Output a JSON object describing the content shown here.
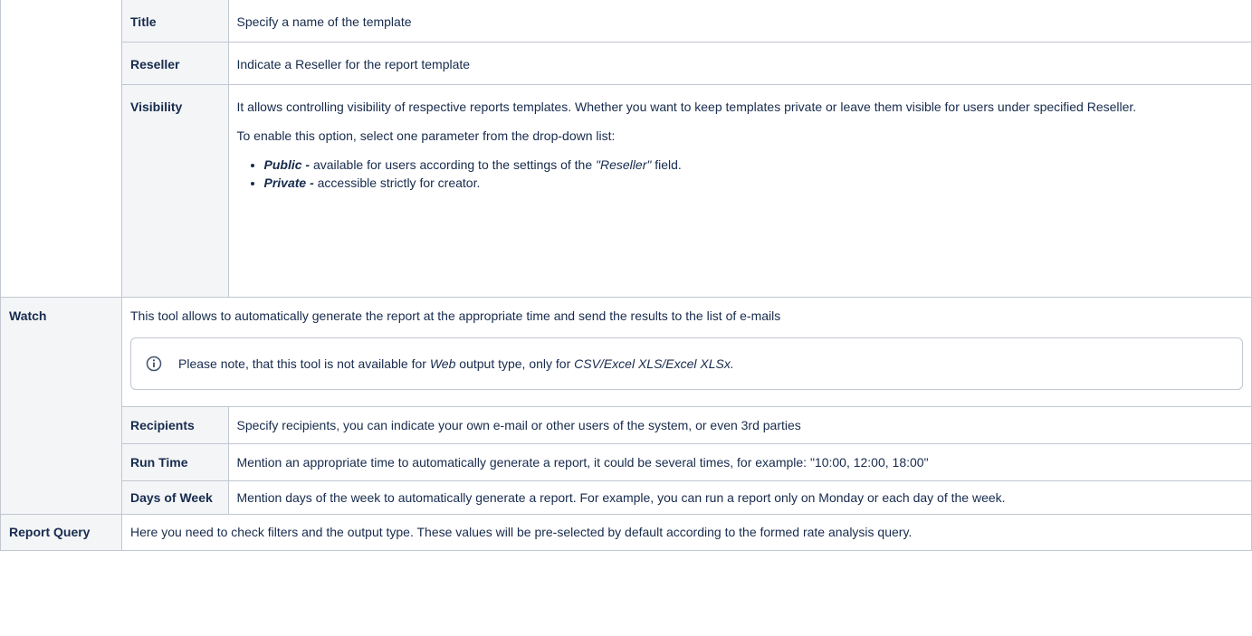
{
  "top_rows": [
    {
      "label": "Title",
      "text": "Specify a name of the template"
    },
    {
      "label": "Reseller",
      "text": "Indicate a Reseller for the report template"
    }
  ],
  "visibility": {
    "label": "Visibility",
    "intro": "It allows controlling visibility of respective reports templates. Whether you want to keep templates private or leave them visible for users under specified Reseller.",
    "instruction": "To enable this option, select one parameter from the drop-down list:",
    "public_term": "Public -",
    "public_text_pre": " available for users according to the settings of the ",
    "public_field": "\"Reseller\"",
    "public_text_post": " field.",
    "private_term": "Private -",
    "private_text": " accessible strictly for creator."
  },
  "watch": {
    "label": "Watch",
    "description": "This tool allows to automatically generate the report at the appropriate time and send the results to the list of e-mails",
    "note_pre": "Please note, that this tool is not available for ",
    "note_web": "Web",
    "note_mid": " output type, only for ",
    "note_types": "CSV/Excel XLS/Excel XLSx.",
    "rows": [
      {
        "label": "Recipients",
        "text": "Specify recipients, you can indicate your own e-mail or other users of the system, or even 3rd parties"
      },
      {
        "label": "Run Time",
        "text": "Mention an appropriate time to automatically generate a report, it could be several times, for example: \"10:00, 12:00, 18:00\""
      },
      {
        "label": "Days of Week",
        "text": "Mention days of the week to automatically generate a report. For example, you can run a report only on Monday or each day of the week."
      }
    ]
  },
  "report_query": {
    "label": "Report Query",
    "text": "Here you need to check filters and the output type. These values will be pre-selected by default according to the formed rate analysis query."
  },
  "colors": {
    "border": "#c1c7d0",
    "header_bg": "#f4f5f7",
    "info_icon": "#2684ff"
  },
  "icons": {
    "info": "info-icon"
  }
}
